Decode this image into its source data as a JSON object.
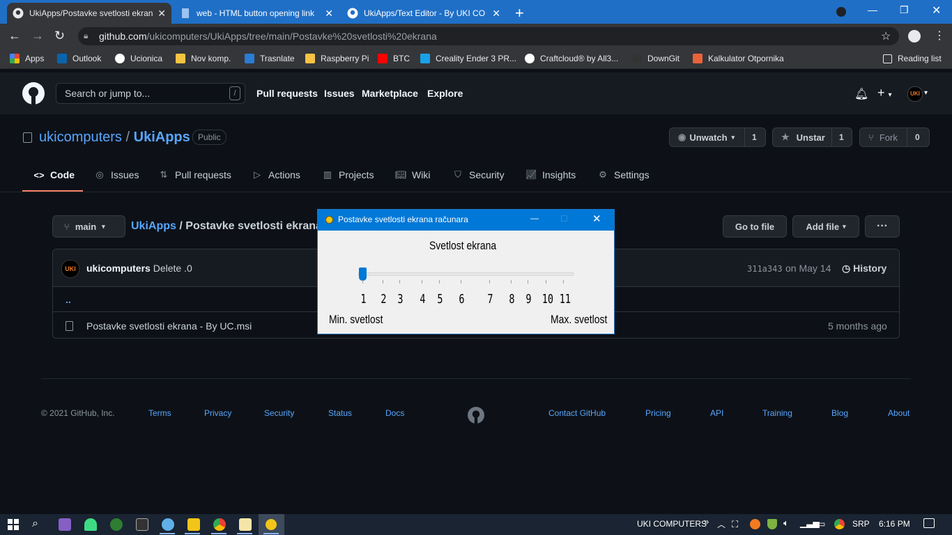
{
  "browser": {
    "tabs": [
      {
        "title": "UkiApps/Postavke svetlosti ekrana",
        "active": true,
        "icon": "github-icon"
      },
      {
        "title": "web - HTML button opening link",
        "active": false,
        "icon": "doc-icon"
      },
      {
        "title": "UkiApps/Text Editor - By UKI CO",
        "active": false,
        "icon": "github-icon"
      }
    ],
    "new_tab": "+",
    "url_domain": "github.com",
    "url_path": "/ukicomputers/UkiApps/tree/main/Postavke%20svetlosti%20ekrana",
    "bookmarks": [
      {
        "label": "Apps",
        "color": "#e94235"
      },
      {
        "label": "Outlook",
        "color": "#0a64ad"
      },
      {
        "label": "Ucionica",
        "color": "#ea4335"
      },
      {
        "label": "Nov komp.",
        "color": "#f6c343"
      },
      {
        "label": "Trasnlate",
        "color": "#2b7cd3"
      },
      {
        "label": "Raspberry Pi",
        "color": "#f6c343"
      },
      {
        "label": "BTC",
        "color": "#ff0000"
      },
      {
        "label": "Creality Ender 3 PR...",
        "color": "#19a1e8"
      },
      {
        "label": "Craftcloud® by All3...",
        "color": "#ffffff"
      },
      {
        "label": "DownGit",
        "color": "#333333"
      },
      {
        "label": "Kalkulator Otpornika",
        "color": "#e8623a"
      }
    ],
    "reading_list": "Reading list"
  },
  "github": {
    "search_placeholder": "Search or jump to...",
    "search_key": "/",
    "nav": [
      "Pull requests",
      "Issues",
      "Marketplace",
      "Explore"
    ],
    "avatar_text": "UKI",
    "owner": "ukicomputers",
    "sep": "/",
    "repo": "UkiApps",
    "visibility": "Public",
    "watch": {
      "label": "Unwatch",
      "count": "1"
    },
    "star": {
      "label": "Unstar",
      "count": "1"
    },
    "fork": {
      "label": "Fork",
      "count": "0"
    },
    "repo_tabs": [
      "Code",
      "Issues",
      "Pull requests",
      "Actions",
      "Projects",
      "Wiki",
      "Security",
      "Insights",
      "Settings"
    ],
    "branch": "main",
    "breadcrumb_repo": "UkiApps",
    "breadcrumb_folder": "Postavke svetlosti ekrana",
    "breadcrumb_sep": "/",
    "go_to_file": "Go to file",
    "add_file": "Add file",
    "more": "···",
    "commit_author": "ukicomputers",
    "commit_message": "Delete .0",
    "commit_hash": "311a343",
    "commit_date": "on May 14",
    "history": "History",
    "parent_dir": "..",
    "files": [
      {
        "name": "Postavke svetlosti ekrana - By UC.msi",
        "age": "5 months ago"
      }
    ],
    "footer_copy": "© 2021 GitHub, Inc.",
    "footer_left": [
      "Terms",
      "Privacy",
      "Security",
      "Status",
      "Docs"
    ],
    "footer_right": [
      "Contact GitHub",
      "Pricing",
      "API",
      "Training",
      "Blog",
      "About"
    ]
  },
  "dialog": {
    "title": "Postavke svetlosti ekrana računara",
    "heading": "Svetlost ekrana",
    "ticks": [
      "1",
      "2",
      "3",
      "4",
      "5",
      "6",
      "7",
      "8",
      "9",
      "10",
      "11"
    ],
    "min_label": "Min. svetlost",
    "max_label": "Max. svetlost",
    "slider_value": 1,
    "minimize": "—",
    "maximize": "□",
    "close": "✕"
  },
  "taskbar": {
    "user": "UKI COMPUTERS",
    "chevron": "»",
    "lang": "SRP",
    "time": "6:16 PM"
  }
}
